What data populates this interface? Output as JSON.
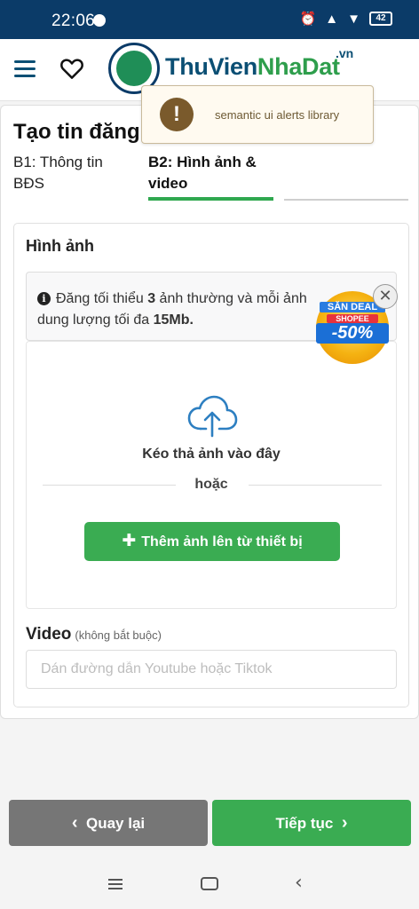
{
  "statusbar": {
    "time": "22:06",
    "battery": "42"
  },
  "header": {
    "logo_part1": "ThuVien",
    "logo_part2": "NhaDat",
    "logo_suffix": ".vn"
  },
  "toast": {
    "message": "semantic ui alerts library"
  },
  "form": {
    "title": "Tạo tin đăng",
    "step1": "B1: Thông tin BĐS",
    "step2": "B2: Hình ảnh & video"
  },
  "images": {
    "section_title": "Hình ảnh",
    "notice_pre": "Đăng tối thiểu ",
    "notice_count": "3",
    "notice_mid": " ảnh thường và mỗi ảnh dung lượng tối đa ",
    "notice_size": "15Mb",
    "notice_end": ".",
    "drop_text": "Kéo thả ảnh vào đây",
    "or_text": "hoặc",
    "add_button": "Thêm ảnh lên từ thiết bị"
  },
  "video": {
    "label": "Video",
    "optional": "(không bắt buộc)",
    "placeholder": "Dán đường dẫn Youtube hoặc Tiktok",
    "value": ""
  },
  "ad": {
    "line1": "SĂN DEAL",
    "line2": "SHOPEE",
    "line3": "-50%"
  },
  "footer": {
    "back": "Quay lại",
    "next": "Tiếp tục"
  },
  "colors": {
    "primary_green": "#3aac52",
    "brand_blue": "#0b4f74",
    "statusbar_bg": "#0b3b68",
    "back_gray": "#767676"
  }
}
